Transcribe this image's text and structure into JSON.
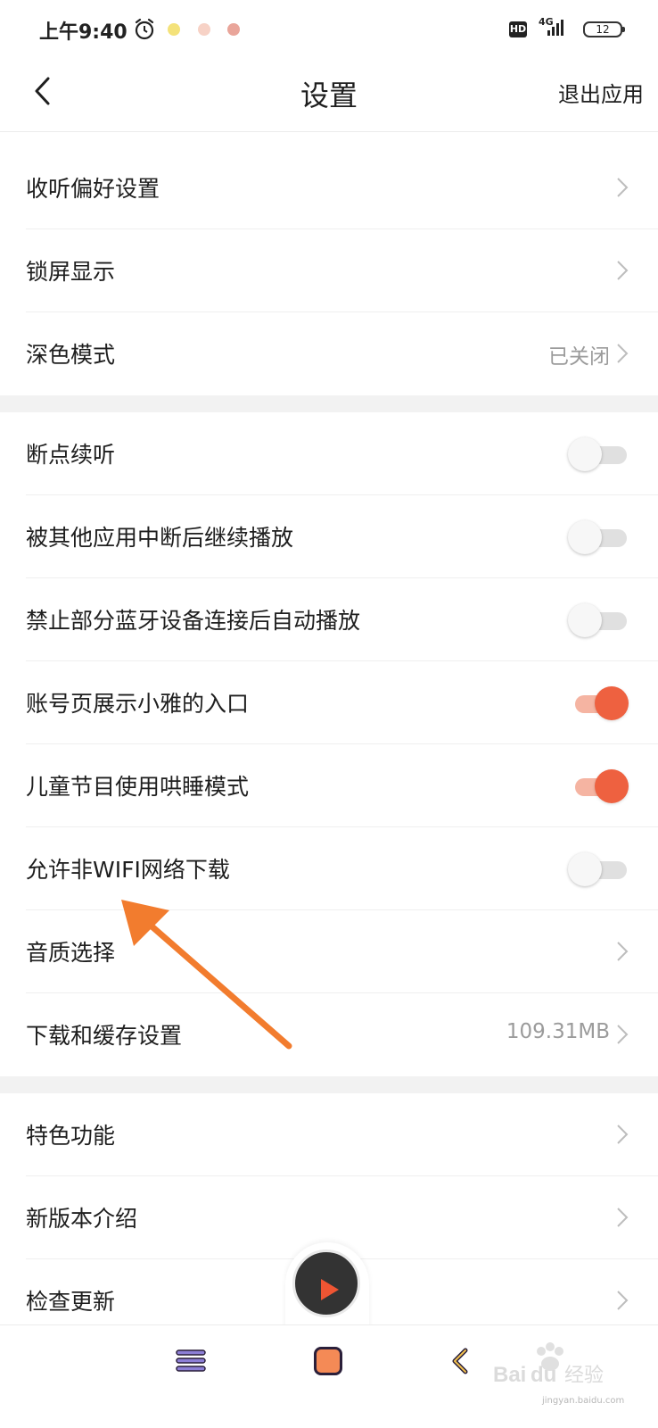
{
  "status_bar": {
    "time": "上午9:40",
    "hd": "HD",
    "network": "4G",
    "battery": "12"
  },
  "header": {
    "title": "设置",
    "exit_label": "退出应用"
  },
  "settings": {
    "group1": [
      {
        "label": "收听偏好设置",
        "value": ""
      },
      {
        "label": "锁屏显示",
        "value": ""
      },
      {
        "label": "深色模式",
        "value": "已关闭"
      }
    ],
    "group2": [
      {
        "label": "断点续听",
        "toggle": false
      },
      {
        "label": "被其他应用中断后继续播放",
        "toggle": false
      },
      {
        "label": "禁止部分蓝牙设备连接后自动播放",
        "toggle": false
      },
      {
        "label": "账号页展示小雅的入口",
        "toggle": true
      },
      {
        "label": "儿童节目使用哄睡模式",
        "toggle": true
      },
      {
        "label": "允许非WIFI网络下载",
        "toggle": false
      },
      {
        "label": "音质选择",
        "value": ""
      },
      {
        "label": "下载和缓存设置",
        "value": "109.31MB"
      }
    ],
    "group3": [
      {
        "label": "特色功能",
        "value": ""
      },
      {
        "label": "新版本介绍",
        "value": ""
      },
      {
        "label": "检查更新",
        "value": ""
      }
    ]
  },
  "colors": {
    "accent": "#ee6140",
    "accent_track": "#f5b4a2",
    "annotation_arrow": "#f27c2e"
  },
  "icons": {
    "back": "chevron-left-icon",
    "row_arrow": "chevron-right-icon",
    "player": "play-icon",
    "nav_menu": "menu-icon",
    "nav_home": "home-icon",
    "nav_back": "back-icon"
  },
  "watermark": {
    "url": "jingyan.baidu.com"
  }
}
